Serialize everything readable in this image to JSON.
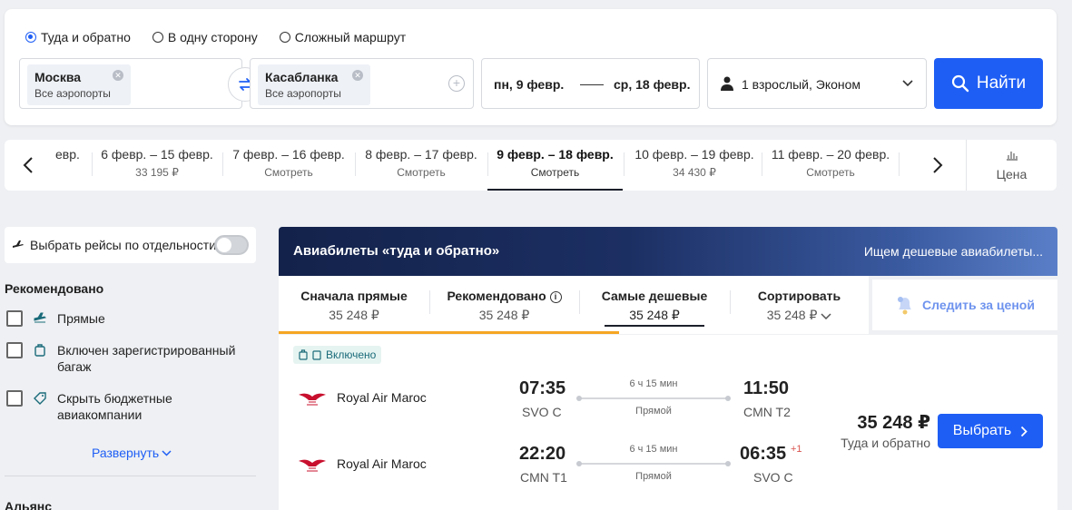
{
  "search": {
    "trip_types": [
      {
        "label": "Туда и обратно",
        "selected": true
      },
      {
        "label": "В одну сторону",
        "selected": false
      },
      {
        "label": "Сложный маршрут",
        "selected": false
      }
    ],
    "from": {
      "city": "Москва",
      "airports": "Все аэропорты"
    },
    "to": {
      "city": "Касабланка",
      "airports": "Все аэропорты"
    },
    "date_there": "пн, 9 февр.",
    "date_back": "ср, 18 февр.",
    "passengers": "1 взрослый, Эконом",
    "find_label": "Найти"
  },
  "dates": {
    "items": [
      {
        "range": "ebr.",
        "price": ""
      },
      {
        "range": "6 февр. – 15 февр.",
        "price": "33 195 ₽"
      },
      {
        "range": "7 февр. – 16 февр.",
        "price": "Смотреть"
      },
      {
        "range": "8 февр. – 17 февр.",
        "price": "Смотреть"
      },
      {
        "range": "9 февр. – 18 февр.",
        "price": "Смотреть",
        "active": true
      },
      {
        "range": "10 февр. – 19 февр.",
        "price": "34 430 ₽"
      },
      {
        "range": "11 февр. – 20 февр.",
        "price": "Смотреть"
      }
    ],
    "partial_first": "евр.",
    "price_toggle": "Цена"
  },
  "sidebar": {
    "separate_label": "Выбрать рейсы по отдельности",
    "recommended_title": "Рекомендовано",
    "filters": [
      {
        "label": "Прямые",
        "icon": "plane-icon"
      },
      {
        "label": "Включен зарегистрированный багаж",
        "icon": "baggage-icon"
      },
      {
        "label": "Скрыть бюджетные авиакомпании",
        "icon": "tag-icon"
      }
    ],
    "expand_label": "Развернуть",
    "alliance_title": "Альянс"
  },
  "results": {
    "banner_title": "Авиабилеты «туда и обратно»",
    "banner_status": "Ищем дешевые авиабилеты...",
    "sort_tabs": [
      {
        "label": "Сначала прямые",
        "price": "35 248 ₽"
      },
      {
        "label": "Рекомендовано",
        "price": "35 248 ₽"
      },
      {
        "label": "Самые дешевые",
        "price": "35 248 ₽",
        "active": true
      },
      {
        "label": "Сортировать",
        "price": "35 248 ₽"
      }
    ],
    "watch_label": "Следить за ценой",
    "card": {
      "included_label": "Включено",
      "legs": [
        {
          "airline": "Royal Air Maroc",
          "dep_time": "07:35",
          "dep_airport": "SVO C",
          "duration": "6 ч 15 мин",
          "stops": "Прямой",
          "arr_time": "11:50",
          "arr_airport": "CMN T2",
          "day_offset": ""
        },
        {
          "airline": "Royal Air Maroc",
          "dep_time": "22:20",
          "dep_airport": "CMN T1",
          "duration": "6 ч 15 мин",
          "stops": "Прямой",
          "arr_time": "06:35",
          "arr_airport": "SVO C",
          "day_offset": "+1"
        }
      ],
      "price": "35 248 ₽",
      "price_note": "Туда и обратно",
      "select_label": "Выбрать"
    }
  },
  "colors": {
    "accent": "#1e5ef5",
    "active_underline": "#f5a623",
    "banner_dark": "#13224a"
  }
}
